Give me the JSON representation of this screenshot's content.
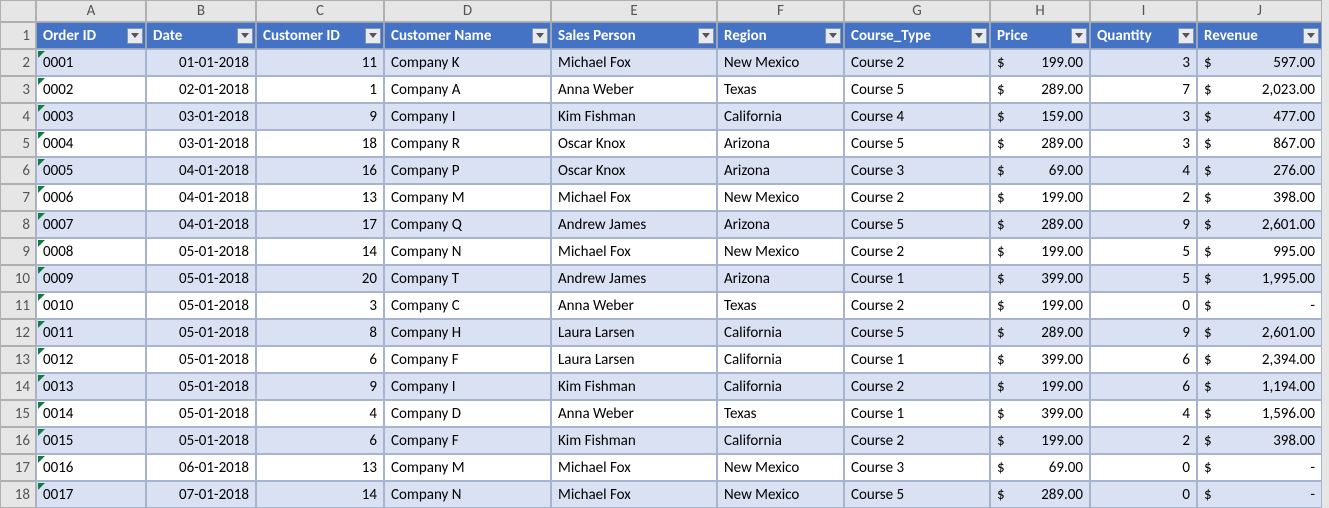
{
  "columns_letters": [
    "A",
    "B",
    "C",
    "D",
    "E",
    "F",
    "G",
    "H",
    "I",
    "J"
  ],
  "headers": [
    "Order ID",
    "Date",
    "Customer ID",
    "Customer Name",
    "Sales Person",
    "Region",
    "Course_Type",
    "Price",
    "Quantity",
    "Revenue"
  ],
  "row_numbers": [
    1,
    2,
    3,
    4,
    5,
    6,
    7,
    8,
    9,
    10,
    11,
    12,
    13,
    14,
    15,
    16,
    17,
    18
  ],
  "currency_symbol": "$",
  "dash": "-",
  "rows": [
    {
      "order_id": "0001",
      "date": "01-01-2018",
      "customer_id": "11",
      "customer_name": "Company K",
      "sales_person": "Michael Fox",
      "region": "New Mexico",
      "course_type": "Course 2",
      "price": "199.00",
      "quantity": "3",
      "revenue": "597.00"
    },
    {
      "order_id": "0002",
      "date": "02-01-2018",
      "customer_id": "1",
      "customer_name": "Company A",
      "sales_person": "Anna Weber",
      "region": "Texas",
      "course_type": "Course 5",
      "price": "289.00",
      "quantity": "7",
      "revenue": "2,023.00"
    },
    {
      "order_id": "0003",
      "date": "03-01-2018",
      "customer_id": "9",
      "customer_name": "Company I",
      "sales_person": "Kim Fishman",
      "region": "California",
      "course_type": "Course 4",
      "price": "159.00",
      "quantity": "3",
      "revenue": "477.00"
    },
    {
      "order_id": "0004",
      "date": "03-01-2018",
      "customer_id": "18",
      "customer_name": "Company R",
      "sales_person": "Oscar Knox",
      "region": "Arizona",
      "course_type": "Course 5",
      "price": "289.00",
      "quantity": "3",
      "revenue": "867.00"
    },
    {
      "order_id": "0005",
      "date": "04-01-2018",
      "customer_id": "16",
      "customer_name": "Company P",
      "sales_person": "Oscar Knox",
      "region": "Arizona",
      "course_type": "Course 3",
      "price": "69.00",
      "quantity": "4",
      "revenue": "276.00"
    },
    {
      "order_id": "0006",
      "date": "04-01-2018",
      "customer_id": "13",
      "customer_name": "Company M",
      "sales_person": "Michael Fox",
      "region": "New Mexico",
      "course_type": "Course 2",
      "price": "199.00",
      "quantity": "2",
      "revenue": "398.00"
    },
    {
      "order_id": "0007",
      "date": "04-01-2018",
      "customer_id": "17",
      "customer_name": "Company Q",
      "sales_person": "Andrew James",
      "region": "Arizona",
      "course_type": "Course 5",
      "price": "289.00",
      "quantity": "9",
      "revenue": "2,601.00"
    },
    {
      "order_id": "0008",
      "date": "05-01-2018",
      "customer_id": "14",
      "customer_name": "Company N",
      "sales_person": "Michael Fox",
      "region": "New Mexico",
      "course_type": "Course 2",
      "price": "199.00",
      "quantity": "5",
      "revenue": "995.00"
    },
    {
      "order_id": "0009",
      "date": "05-01-2018",
      "customer_id": "20",
      "customer_name": "Company T",
      "sales_person": "Andrew James",
      "region": "Arizona",
      "course_type": "Course 1",
      "price": "399.00",
      "quantity": "5",
      "revenue": "1,995.00"
    },
    {
      "order_id": "0010",
      "date": "05-01-2018",
      "customer_id": "3",
      "customer_name": "Company C",
      "sales_person": "Anna Weber",
      "region": "Texas",
      "course_type": "Course 2",
      "price": "199.00",
      "quantity": "0",
      "revenue": null
    },
    {
      "order_id": "0011",
      "date": "05-01-2018",
      "customer_id": "8",
      "customer_name": "Company H",
      "sales_person": "Laura Larsen",
      "region": "California",
      "course_type": "Course 5",
      "price": "289.00",
      "quantity": "9",
      "revenue": "2,601.00"
    },
    {
      "order_id": "0012",
      "date": "05-01-2018",
      "customer_id": "6",
      "customer_name": "Company F",
      "sales_person": "Laura Larsen",
      "region": "California",
      "course_type": "Course 1",
      "price": "399.00",
      "quantity": "6",
      "revenue": "2,394.00"
    },
    {
      "order_id": "0013",
      "date": "05-01-2018",
      "customer_id": "9",
      "customer_name": "Company I",
      "sales_person": "Kim Fishman",
      "region": "California",
      "course_type": "Course 2",
      "price": "199.00",
      "quantity": "6",
      "revenue": "1,194.00"
    },
    {
      "order_id": "0014",
      "date": "05-01-2018",
      "customer_id": "4",
      "customer_name": "Company D",
      "sales_person": "Anna Weber",
      "region": "Texas",
      "course_type": "Course 1",
      "price": "399.00",
      "quantity": "4",
      "revenue": "1,596.00"
    },
    {
      "order_id": "0015",
      "date": "05-01-2018",
      "customer_id": "6",
      "customer_name": "Company F",
      "sales_person": "Kim Fishman",
      "region": "California",
      "course_type": "Course 2",
      "price": "199.00",
      "quantity": "2",
      "revenue": "398.00"
    },
    {
      "order_id": "0016",
      "date": "06-01-2018",
      "customer_id": "13",
      "customer_name": "Company M",
      "sales_person": "Michael Fox",
      "region": "New Mexico",
      "course_type": "Course 3",
      "price": "69.00",
      "quantity": "0",
      "revenue": null
    },
    {
      "order_id": "0017",
      "date": "07-01-2018",
      "customer_id": "14",
      "customer_name": "Company N",
      "sales_person": "Michael Fox",
      "region": "New Mexico",
      "course_type": "Course 5",
      "price": "289.00",
      "quantity": "0",
      "revenue": null
    }
  ]
}
